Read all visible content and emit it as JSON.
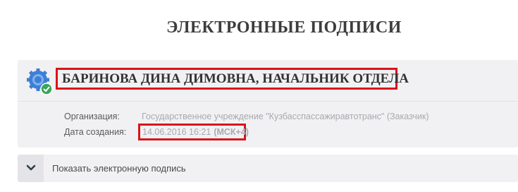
{
  "page": {
    "title": "ЭЛЕКТРОННЫЕ ПОДПИСИ"
  },
  "signature": {
    "signer": "БАРИНОВА ДИНА ДИМОВНА, НАЧАЛЬНИК ОТДЕЛА",
    "organization_label": "Организация:",
    "organization_value": "Государственное учреждение \"Кузбасспассажиравтотранс\" (Заказчик)",
    "created_label": "Дата создания:",
    "created_value": "14.06.2016 16:21",
    "created_tz": "(МСК+4)"
  },
  "toggle": {
    "label": "Показать электронную подпись"
  },
  "icons": {
    "certificate": "certificate-badge-icon",
    "verified": "check-icon",
    "expand": "chevron-down-icon"
  },
  "colors": {
    "highlight": "#d8141a",
    "verified": "#3aa65a",
    "badge": "#3d7fd6"
  }
}
